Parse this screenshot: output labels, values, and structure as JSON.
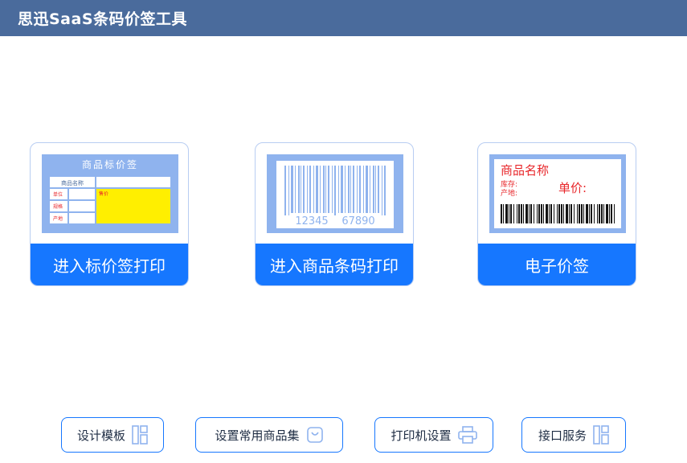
{
  "window": {
    "title": "思迅SaaS条码价签工具"
  },
  "cards": [
    {
      "label": "进入标价签打印",
      "preview": {
        "heading": "商品标价签",
        "field_name": "商品名称",
        "field_unit": "单位",
        "field_spec": "规格",
        "field_origin": "产地",
        "field_price": "售价"
      }
    },
    {
      "label": "进入商品条码打印",
      "preview": {
        "code_left": "12345",
        "code_right": "67890"
      }
    },
    {
      "label": "电子价签",
      "preview": {
        "name": "商品名称",
        "stock": "库存:",
        "origin": "产地:",
        "price_label": "单价:"
      }
    }
  ],
  "bottom_buttons": [
    {
      "label": "设计模板",
      "icon": "layout-icon"
    },
    {
      "label": "设置常用商品集",
      "icon": "bag-icon"
    },
    {
      "label": "打印机设置",
      "icon": "printer-icon"
    },
    {
      "label": "接口服务",
      "icon": "layout-icon"
    }
  ],
  "colors": {
    "titlebar": "#4a6b9c",
    "accent": "#1677ff",
    "preview_bg": "#8fb3ee",
    "price_yellow": "#ffef00",
    "red_text": "#e8262a"
  }
}
